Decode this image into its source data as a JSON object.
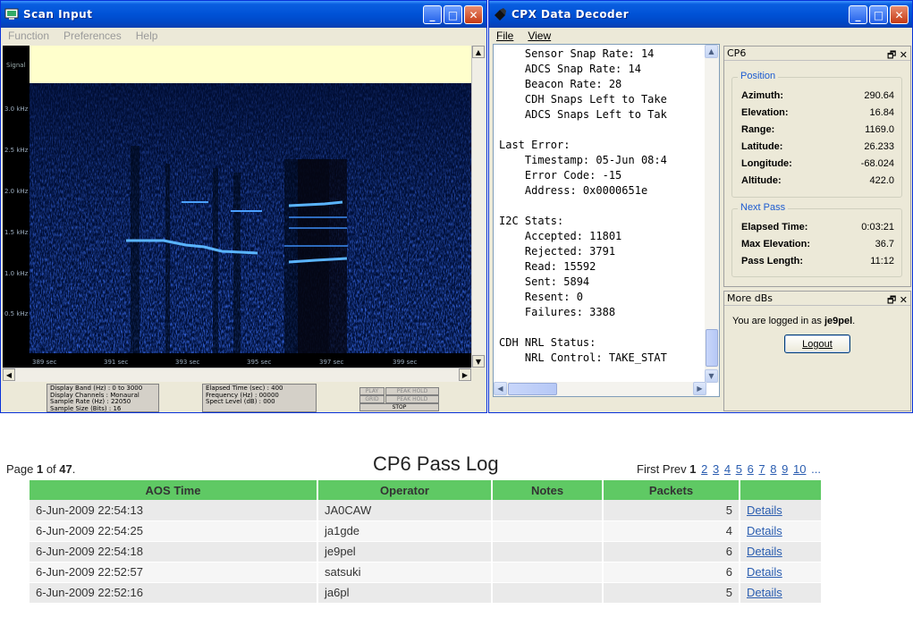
{
  "scan_window": {
    "title": "Scan Input",
    "menu": [
      "Function",
      "Preferences",
      "Help"
    ],
    "signal_label": "Signal",
    "y_ticks": [
      "3.0 kHz",
      "2.5 kHz",
      "2.0 kHz",
      "1.5 kHz",
      "1.0 kHz",
      "0.5 kHz"
    ],
    "x_ticks": [
      "389 sec",
      "391 sec",
      "393 sec",
      "395 sec",
      "397 sec",
      "399 sec"
    ],
    "info_left": [
      "Display Band (Hz) : 0 to 3000",
      "Display Channels : Monaural",
      "Sample Rate (Hz) : 22050",
      "Sample Size (Bits) : 16"
    ],
    "info_right": [
      "Elapsed Time (sec) : 400",
      "Frequency (Hz) : 00000",
      "Spect Level (dB) : 000"
    ],
    "buttons": [
      "PLAY",
      "PEAK HOLD",
      "GRID",
      "PEAK HOLD",
      "STOP"
    ]
  },
  "cpx_window": {
    "title": "CPX Data Decoder",
    "menu": [
      "File",
      "View"
    ],
    "decoder_lines": [
      "    Sensor Snap Rate: 14",
      "    ADCS Snap Rate: 14",
      "    Beacon Rate: 28",
      "    CDH Snaps Left to Take",
      "    ADCS Snaps Left to Tak",
      "",
      "Last Error:",
      "    Timestamp: 05-Jun 08:4",
      "    Error Code: -15",
      "    Address: 0x0000651e",
      "",
      "I2C Stats:",
      "    Accepted: 11801",
      "    Rejected: 3791",
      "    Read: 15592",
      "    Sent: 5894",
      "    Resent: 0",
      "    Failures: 3388",
      "",
      "CDH NRL Status:",
      "    NRL Control: TAKE_STAT"
    ],
    "cp6_panel": {
      "title": "CP6",
      "position_legend": "Position",
      "position": [
        {
          "label": "Azimuth:",
          "value": "290.64"
        },
        {
          "label": "Elevation:",
          "value": "16.84"
        },
        {
          "label": "Range:",
          "value": "1169.0"
        },
        {
          "label": "Latitude:",
          "value": "26.233"
        },
        {
          "label": "Longitude:",
          "value": "-68.024"
        },
        {
          "label": "Altitude:",
          "value": "422.0"
        }
      ],
      "next_pass_legend": "Next Pass",
      "next_pass": [
        {
          "label": "Elapsed Time:",
          "value": "0:03:21"
        },
        {
          "label": "Max Elevation:",
          "value": "36.7"
        },
        {
          "label": "Pass Length:",
          "value": "11:12"
        }
      ]
    },
    "dbs_panel": {
      "title": "More dBs",
      "login_text": "You are logged in as ",
      "user": "je9pel",
      "login_suffix": ".",
      "logout_label": "Logout"
    }
  },
  "pass_log": {
    "page_prefix": "Page ",
    "page_current": "1",
    "page_mid": " of ",
    "page_total": "47",
    "page_suffix": ".",
    "title": "CP6 Pass Log",
    "pager_first": "First",
    "pager_prev": "Prev",
    "pager_current": "1",
    "pager_links": [
      "2",
      "3",
      "4",
      "5",
      "6",
      "7",
      "8",
      "9",
      "10",
      "..."
    ],
    "columns": [
      "AOS Time",
      "Operator",
      "Notes",
      "Packets",
      ""
    ],
    "rows": [
      {
        "aos": "6-Jun-2009 22:54:13",
        "operator": "JA0CAW",
        "notes": "",
        "packets": "5",
        "link": "Details"
      },
      {
        "aos": "6-Jun-2009 22:54:25",
        "operator": "ja1gde",
        "notes": "",
        "packets": "4",
        "link": "Details"
      },
      {
        "aos": "6-Jun-2009 22:54:18",
        "operator": "je9pel",
        "notes": "",
        "packets": "6",
        "link": "Details"
      },
      {
        "aos": "6-Jun-2009 22:52:57",
        "operator": "satsuki",
        "notes": "",
        "packets": "6",
        "link": "Details"
      },
      {
        "aos": "6-Jun-2009 22:52:16",
        "operator": "ja6pl",
        "notes": "",
        "packets": "5",
        "link": "Details"
      }
    ]
  }
}
